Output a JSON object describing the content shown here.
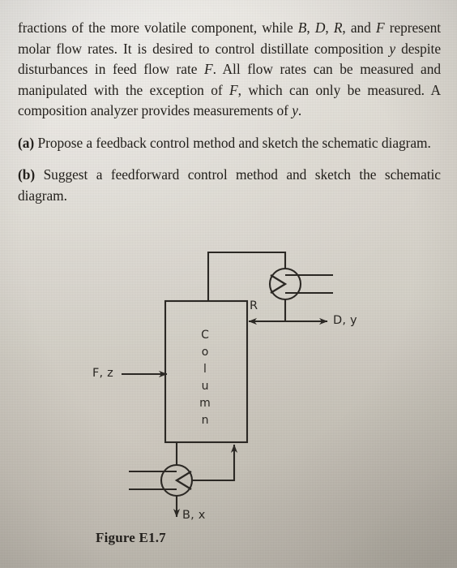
{
  "page": {
    "background_color": "#d6d2ca",
    "ink_color": "#23201c"
  },
  "body_text": {
    "paragraph_1_lines": [
      "fractions of the more volatile component, while B, D, R, and",
      "F represent molar flow rates. It is desired to control distillate",
      "composition y despite disturbances in feed flow rate F. All flow",
      "rates can be measured and manipulated with the exception",
      "of F, which can only be measured. A composition analyzer",
      "provides measurements of y."
    ],
    "item_a": {
      "marker": "(a)",
      "line_1": "Propose a feedback control method and sketch the",
      "line_2": "schematic diagram."
    },
    "item_b": {
      "marker": "(b)",
      "line_1": "Suggest a feedforward control method and sketch the",
      "line_2": "schematic diagram."
    }
  },
  "figure": {
    "caption": "Figure E1.7",
    "column_label_letters": [
      "C",
      "o",
      "l",
      "u",
      "m",
      "n"
    ],
    "column_label_text": "Column",
    "stream_labels": {
      "feed": "F, z",
      "reflux": "R",
      "distillate": "D, y",
      "bottoms": "B, x"
    },
    "equipment": {
      "condenser_name": "condenser",
      "reboiler_name": "reboiler",
      "column_name": "distillation-column"
    },
    "line_color": "#2b2824"
  }
}
